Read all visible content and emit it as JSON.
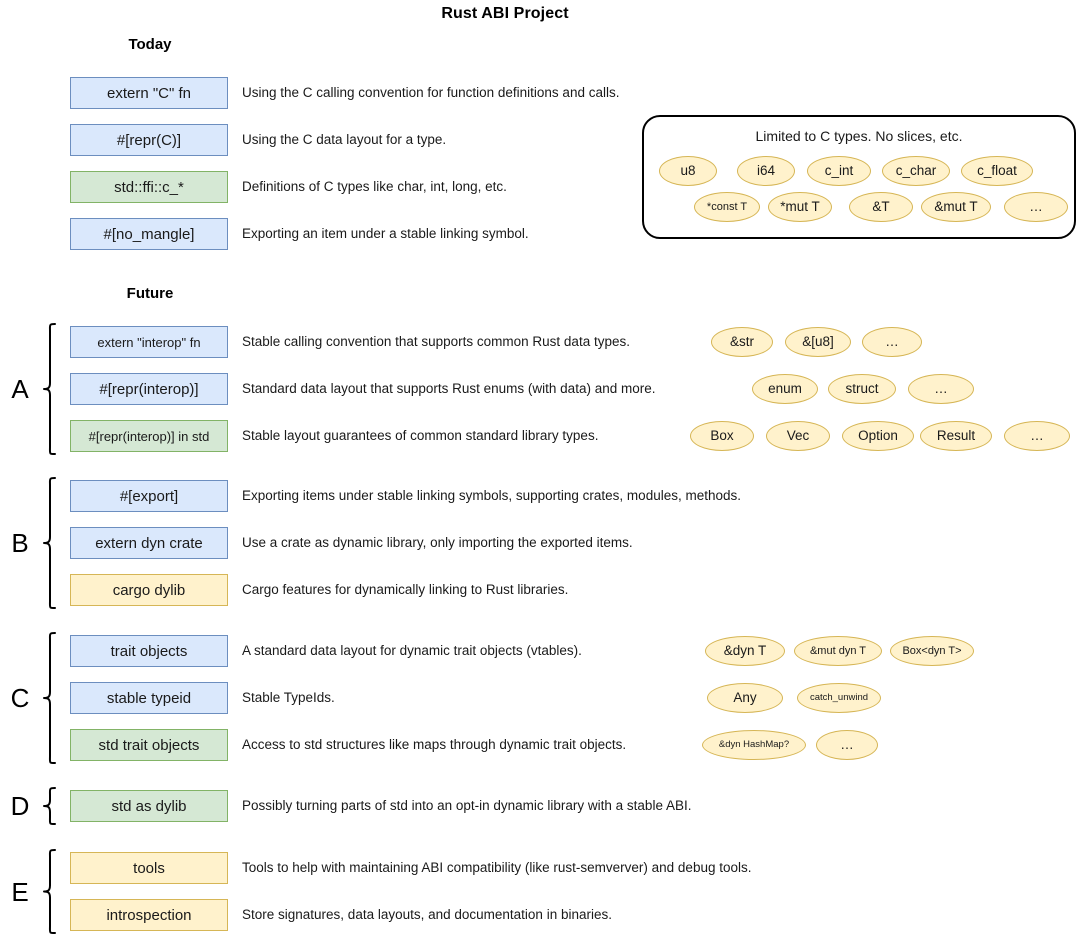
{
  "title": "Rust ABI Project",
  "headings": {
    "today": "Today",
    "future": "Future"
  },
  "today_rows": [
    {
      "label": "extern \"C\" fn",
      "color": "blue",
      "desc": "Using the C calling convention for function definitions and calls."
    },
    {
      "label": "#[repr(C)]",
      "color": "blue",
      "desc": "Using the C data layout for a type."
    },
    {
      "label": "std::ffi::c_*",
      "color": "green",
      "desc": "Definitions of C types like char, int, long, etc."
    },
    {
      "label": "#[no_mangle]",
      "color": "blue",
      "desc": "Exporting an item under a stable linking symbol."
    }
  ],
  "ctypes_panel": {
    "caption": "Limited to C types. No slices, etc.",
    "row1": [
      "u8",
      "i64",
      "c_int",
      "c_char",
      "c_float"
    ],
    "row2": [
      "*const T",
      "*mut T",
      "&T",
      "&mut T",
      "…"
    ]
  },
  "groups": [
    {
      "letter": "A",
      "rows": [
        {
          "label": "extern \"interop\" fn",
          "color": "blue",
          "desc": "Stable calling convention that supports common Rust data types.",
          "chips": [
            "&str",
            "&[u8]",
            "…"
          ]
        },
        {
          "label": "#[repr(interop)]",
          "color": "blue",
          "desc": "Standard data layout that supports Rust enums (with data) and more.",
          "chips": [
            "enum",
            "struct",
            "…"
          ]
        },
        {
          "label": "#[repr(interop)] in std",
          "color": "green",
          "desc": "Stable layout guarantees of common standard library types.",
          "chips": [
            "Box",
            "Vec",
            "Option",
            "Result",
            "…"
          ]
        }
      ]
    },
    {
      "letter": "B",
      "rows": [
        {
          "label": "#[export]",
          "color": "blue",
          "desc": "Exporting items under stable linking symbols, supporting crates, modules, methods.",
          "chips": []
        },
        {
          "label": "extern dyn crate",
          "color": "blue",
          "desc": "Use a crate as dynamic library, only importing the exported items.",
          "chips": []
        },
        {
          "label": "cargo dylib",
          "color": "yellow",
          "desc": "Cargo features for dynamically linking to Rust libraries.",
          "chips": []
        }
      ]
    },
    {
      "letter": "C",
      "rows": [
        {
          "label": "trait objects",
          "color": "blue",
          "desc": "A standard data layout for dynamic trait objects (vtables).",
          "chips": [
            "&dyn T",
            "&mut dyn T",
            "Box<dyn T>"
          ]
        },
        {
          "label": "stable typeid",
          "color": "blue",
          "desc": "Stable TypeIds.",
          "chips": [
            "Any",
            "catch_unwind"
          ]
        },
        {
          "label": "std trait objects",
          "color": "green",
          "desc": "Access to std structures like maps through dynamic trait objects.",
          "chips": [
            "&dyn HashMap?",
            "…"
          ]
        }
      ]
    },
    {
      "letter": "D",
      "rows": [
        {
          "label": "std as dylib",
          "color": "green",
          "desc": "Possibly turning parts of std into an opt-in dynamic library with a stable ABI.",
          "chips": []
        }
      ]
    },
    {
      "letter": "E",
      "rows": [
        {
          "label": "tools",
          "color": "yellow",
          "desc": "Tools to help with maintaining ABI compatibility (like rust-semverver) and debug tools.",
          "chips": []
        },
        {
          "label": "introspection",
          "color": "yellow",
          "desc": "Store signatures, data layouts, and documentation in binaries.",
          "chips": []
        }
      ]
    }
  ],
  "colors": {
    "blue_fill": "#dae8fc",
    "blue_stroke": "#6c8ebf",
    "green_fill": "#d5e8d4",
    "green_stroke": "#82b366",
    "yellow_fill": "#fff2cc",
    "yellow_stroke": "#d6b656",
    "panel_stroke": "#000000",
    "text": "#1a1a1a"
  }
}
